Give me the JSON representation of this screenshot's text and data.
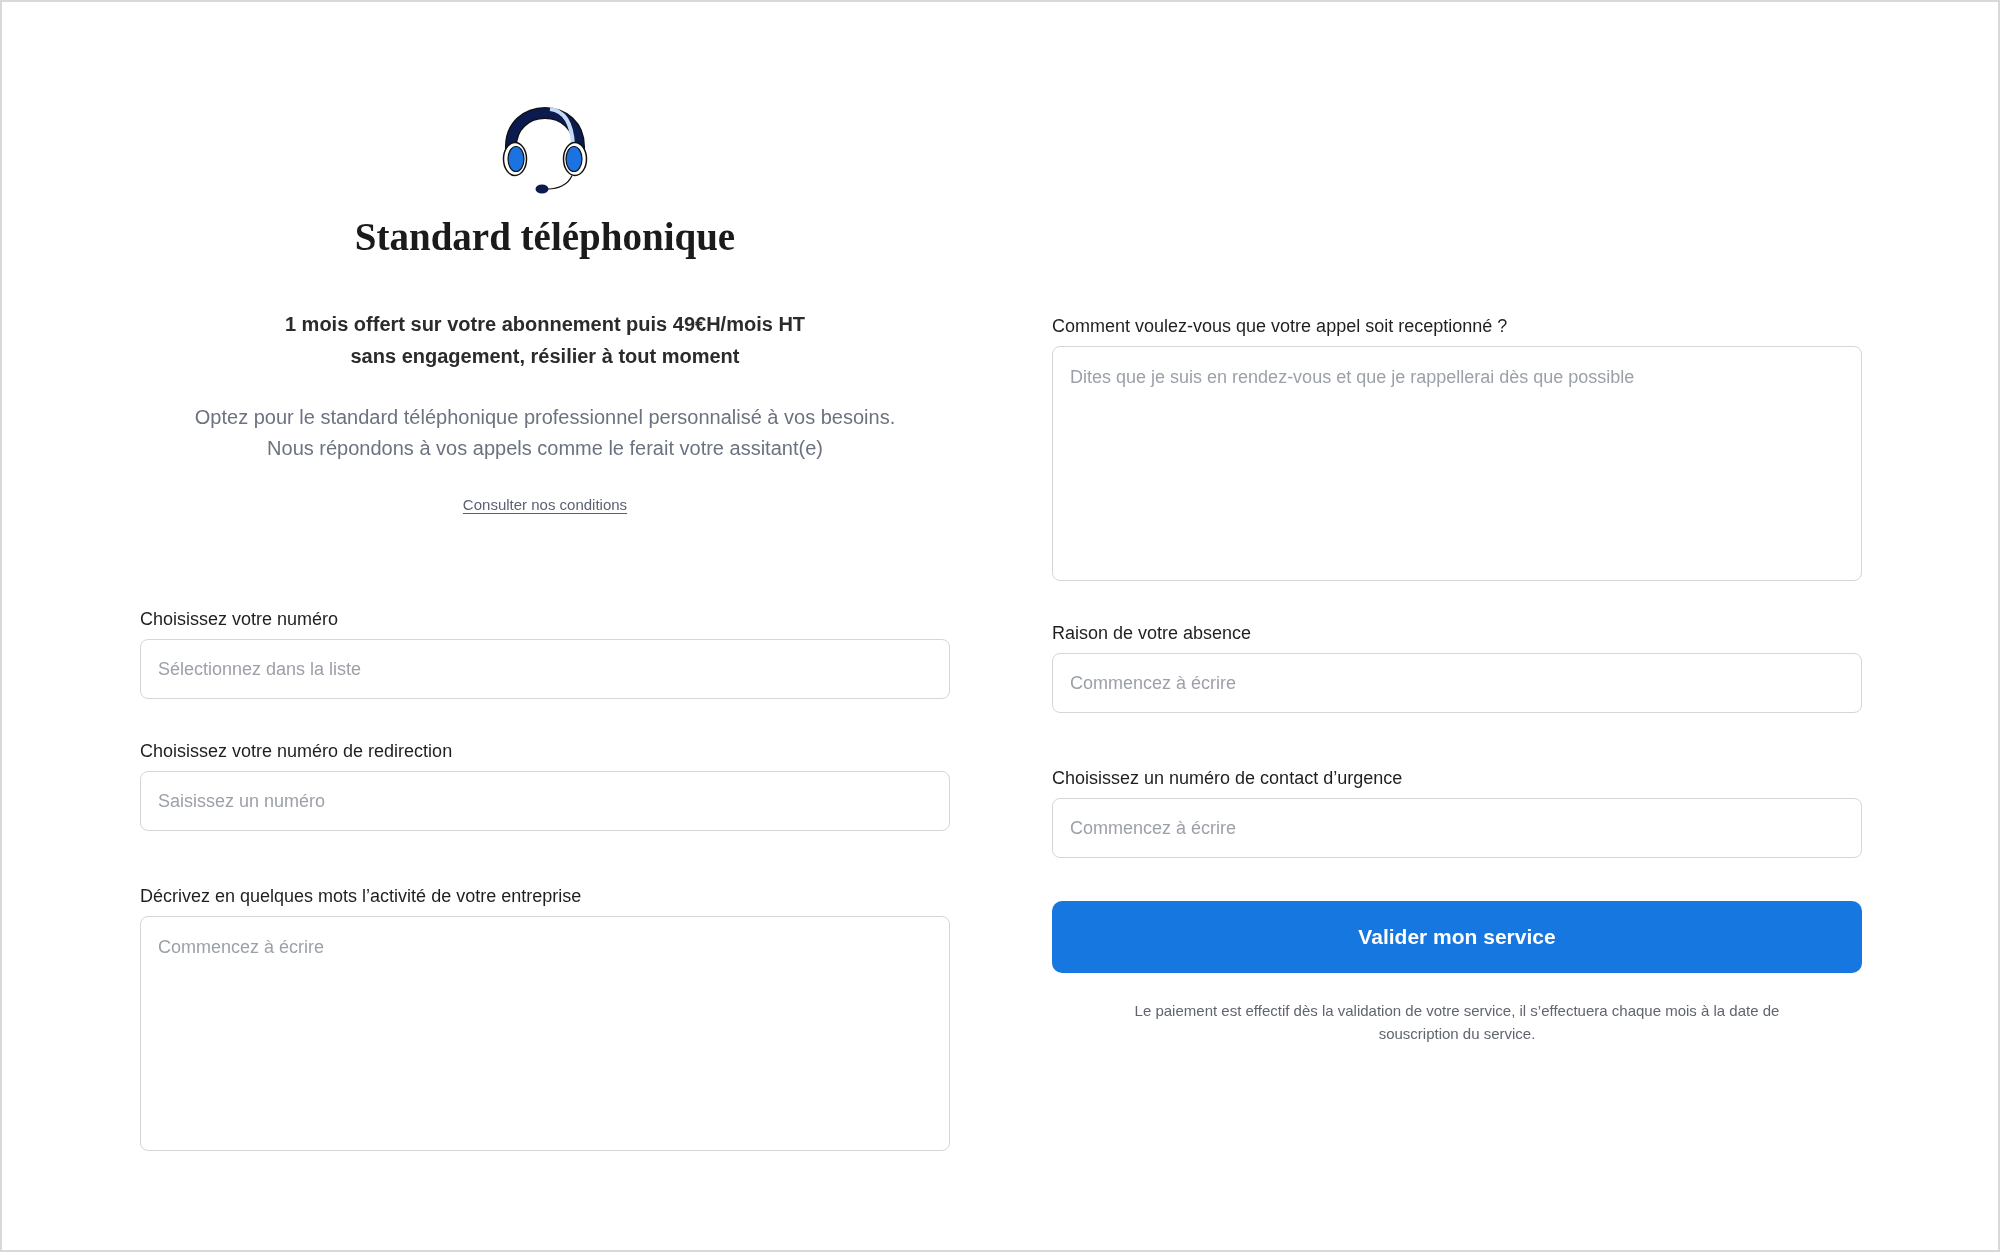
{
  "header": {
    "title": "Standard téléphonique",
    "offer_lines": [
      "1 mois offert sur votre abonnement puis 49€H/mois HT",
      "sans engagement, résilier à tout moment"
    ],
    "description_lines": [
      "Optez pour le standard téléphonique professionnel personnalisé à vos besoins.",
      "Nous répondons à vos appels comme le ferait votre assitant(e)"
    ],
    "link": "Consulter nos conditions"
  },
  "form_left": {
    "fields": [
      {
        "kind": "input",
        "label": "Choisissez votre numéro",
        "placeholder": "Sélectionnez dans la liste"
      },
      {
        "kind": "input",
        "label": "Choisissez votre numéro de redirection",
        "placeholder": "Saisissez un numéro"
      },
      {
        "kind": "textarea",
        "label": "Décrivez en quelques mots l’activité de votre entreprise",
        "placeholder": "Commencez à écrire"
      }
    ]
  },
  "form_right": {
    "fields": [
      {
        "kind": "textarea",
        "label": "Comment voulez-vous que votre appel soit receptionné ?",
        "placeholder": "Dites que je suis en rendez-vous et que je rappellerai dès que possible"
      },
      {
        "kind": "input",
        "label": "Raison de votre absence",
        "placeholder": "Commencez à écrire"
      },
      {
        "kind": "input",
        "label": "Choisissez un numéro de contact d’urgence",
        "placeholder": "Commencez à écrire"
      }
    ]
  },
  "submit_button": "Valider mon service",
  "payment_note": "Le paiement est effectif dès la validation de votre service, il s’effectuera chaque mois à la date de souscription du service."
}
